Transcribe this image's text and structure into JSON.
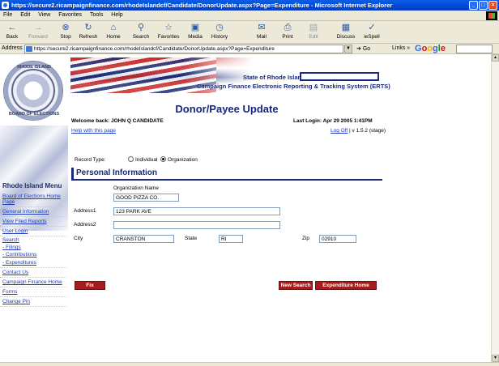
{
  "window": {
    "title": "https://secure2.ricampaignfinance.com/rhodeIslandcf/Candidate/DonorUpdate.aspx?Page=Expenditure - Microsoft Internet Explorer",
    "min": "_",
    "max": "□",
    "close": "×"
  },
  "menubar": [
    "File",
    "Edit",
    "View",
    "Favorites",
    "Tools",
    "Help"
  ],
  "toolbar": [
    {
      "label": "Back",
      "icon": "←"
    },
    {
      "label": "Forward",
      "icon": "→"
    },
    {
      "label": "Stop",
      "icon": "⊗"
    },
    {
      "label": "Refresh",
      "icon": "↻"
    },
    {
      "label": "Home",
      "icon": "⌂"
    },
    {
      "label": "Search",
      "icon": "⚲"
    },
    {
      "label": "Favorites",
      "icon": "☆"
    },
    {
      "label": "Media",
      "icon": "▣"
    },
    {
      "label": "History",
      "icon": "◷"
    },
    {
      "label": "Mail",
      "icon": "✉"
    },
    {
      "label": "Print",
      "icon": "⎙"
    },
    {
      "label": "Edit",
      "icon": "▤"
    },
    {
      "label": "Discuss",
      "icon": "▦"
    },
    {
      "label": "ieSpell",
      "icon": "✓"
    }
  ],
  "address": {
    "label": "Address",
    "url": "https://secure2.ricampaignfinance.com/rhodeIslandcf/Candidate/DonorUpdate.aspx?Page=Expenditure",
    "go": "Go",
    "links": "Links »",
    "google": [
      "G",
      "o",
      "o",
      "g",
      "l",
      "e"
    ]
  },
  "seal": {
    "top": "RHODE ISLAND",
    "bottom": "BOARD OF ELECTIONS"
  },
  "header": {
    "state": "State of Rhode Island",
    "system": "Campaign Finance Electronic Reporting & Tracking System (ERTS)"
  },
  "page": {
    "title": "Donor/Payee Update",
    "welcome": "Welcome back: JOHN Q CANDIDATE",
    "last_login": "Last Login: Apr 29 2005 1:41PM",
    "help": "Help with this page",
    "logoff": "Log Off",
    "version": "| v 1.5.2 (stage)"
  },
  "sidebar": {
    "title": "Rhode Island Menu",
    "items": [
      "Board of Elections Home Page",
      "General Information",
      "View Filed Reports",
      "User Login"
    ],
    "search": "Search",
    "search_sub": [
      "- Filings",
      "- Contributions",
      "- Expenditures"
    ],
    "items2": [
      "Contact Us",
      "Campaign Finance Home",
      "Forms",
      "Change Pin"
    ]
  },
  "form": {
    "record_type_label": "Record Type:",
    "individual": "Individual",
    "organization": "Organization",
    "selected": "Organization",
    "section": "Personal Information",
    "org_name_label": "Organization Name",
    "org_name": "GOOD PIZZA CO.",
    "address1_label": "Address1",
    "address1": "123 PARK AVE",
    "address2_label": "Address2",
    "address2": "",
    "city_label": "City",
    "city": "CRANSTON",
    "state_label": "State",
    "state": "RI",
    "zip_label": "Zip",
    "zip": "02910"
  },
  "buttons": {
    "fix": "Fix",
    "new_search": "New Search",
    "expenditure_home": "Expenditure Home"
  }
}
